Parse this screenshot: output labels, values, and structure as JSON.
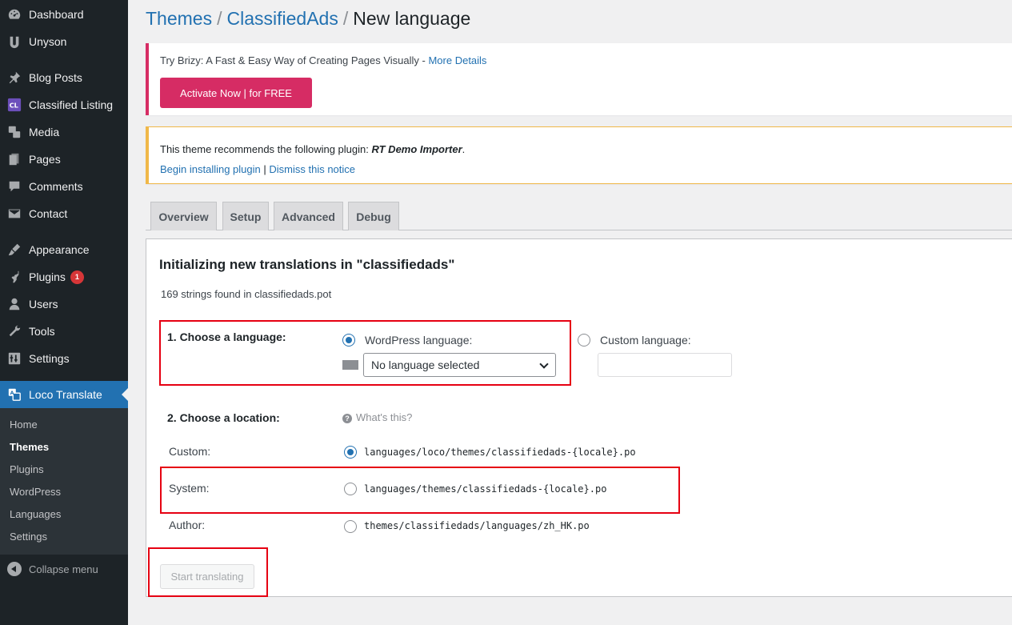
{
  "sidebar": {
    "items": [
      {
        "label": "Dashboard",
        "icon": "dashboard-icon"
      },
      {
        "label": "Unyson",
        "icon": "unyson-icon"
      },
      {
        "label": "Blog Posts",
        "icon": "pin-icon"
      },
      {
        "label": "Classified Listing",
        "icon": "classified-listing-icon"
      },
      {
        "label": "Media",
        "icon": "media-icon"
      },
      {
        "label": "Pages",
        "icon": "pages-icon"
      },
      {
        "label": "Comments",
        "icon": "comments-icon"
      },
      {
        "label": "Contact",
        "icon": "mail-icon"
      },
      {
        "label": "Appearance",
        "icon": "brush-icon"
      },
      {
        "label": "Plugins",
        "icon": "plugin-icon",
        "badge": "1"
      },
      {
        "label": "Users",
        "icon": "users-icon"
      },
      {
        "label": "Tools",
        "icon": "wrench-icon"
      },
      {
        "label": "Settings",
        "icon": "settings-icon"
      },
      {
        "label": "Loco Translate",
        "icon": "translate-icon",
        "active": true
      }
    ],
    "submenu": [
      "Home",
      "Themes",
      "Plugins",
      "WordPress",
      "Languages",
      "Settings"
    ],
    "collapse_label": "Collapse menu"
  },
  "breadcrumb": {
    "crumb1": "Themes",
    "crumb2": "ClassifiedAds",
    "current": "New language",
    "separator": "/"
  },
  "brizy_notice": {
    "text": "Try Brizy: A Fast & Easy Way of Creating Pages Visually - ",
    "link": "More Details",
    "button": "Activate Now | for FREE",
    "accent": "#d62c64"
  },
  "recommend_notice": {
    "text": "This theme recommends the following plugin: ",
    "plugin": "RT Demo Importer",
    "text_end": ".",
    "install_link": "Begin installing plugin",
    "divider": " | ",
    "dismiss_link": "Dismiss this notice"
  },
  "tabs": [
    "Overview",
    "Setup",
    "Advanced",
    "Debug"
  ],
  "panel": {
    "title": "Initializing new translations in \"classifiedads\"",
    "strings_found": "169 strings found in classifiedads.pot",
    "step1_label": "1. Choose a language:",
    "wp_language_label": "WordPress language:",
    "wp_language_checked": true,
    "language_select_value": "No language selected",
    "custom_language_label": "Custom language:",
    "custom_language_value": "",
    "step2_label": "2. Choose a location:",
    "whats_this": "What's this?",
    "locations": [
      {
        "name": "Custom:",
        "path": "languages/loco/themes/classifiedads-{locale}.po",
        "checked": true
      },
      {
        "name": "System:",
        "path": "languages/themes/classifiedads-{locale}.po",
        "checked": false
      },
      {
        "name": "Author:",
        "path": "themes/classifiedads/languages/zh_HK.po",
        "checked": false
      }
    ],
    "start_button": "Start translating"
  },
  "colors": {
    "sidebar_bg": "#1d2327",
    "active_blue": "#2271b1",
    "annotation_red": "#e60012"
  }
}
